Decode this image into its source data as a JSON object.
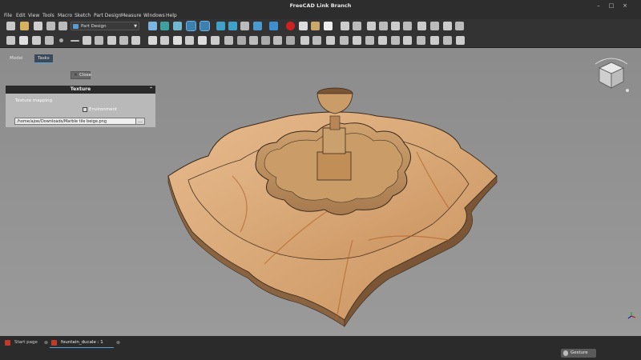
{
  "window": {
    "title": "FreeCAD Link Branch",
    "minimize": "–",
    "maximize": "□",
    "close": "×"
  },
  "menu": [
    "File",
    "Edit",
    "View",
    "Tools",
    "Macro",
    "Sketch",
    "Part Design",
    "Measure",
    "Windows",
    "Help"
  ],
  "toolbar": {
    "workbench": "Part Design"
  },
  "combo_view": {
    "tabs": [
      "Model",
      "Tasks"
    ],
    "active_tab": "Tasks",
    "close_label": "Close",
    "panel": {
      "title": "Texture",
      "texture_mapping_label": "Texture mapping",
      "environment_label": "Environment",
      "file_path": "/home/ajoe/Downloads/Marble tile beige.png",
      "browse_label": "..."
    }
  },
  "documents": {
    "tabs": [
      "Start page",
      "fountain_ducale : 1"
    ],
    "active": "fountain_ducale : 1"
  },
  "status": {
    "navigation_style": "Gesture"
  },
  "colors": {
    "accent": "#5aa0d8",
    "marble": "#d9a877",
    "background": "#9a9a9a"
  }
}
